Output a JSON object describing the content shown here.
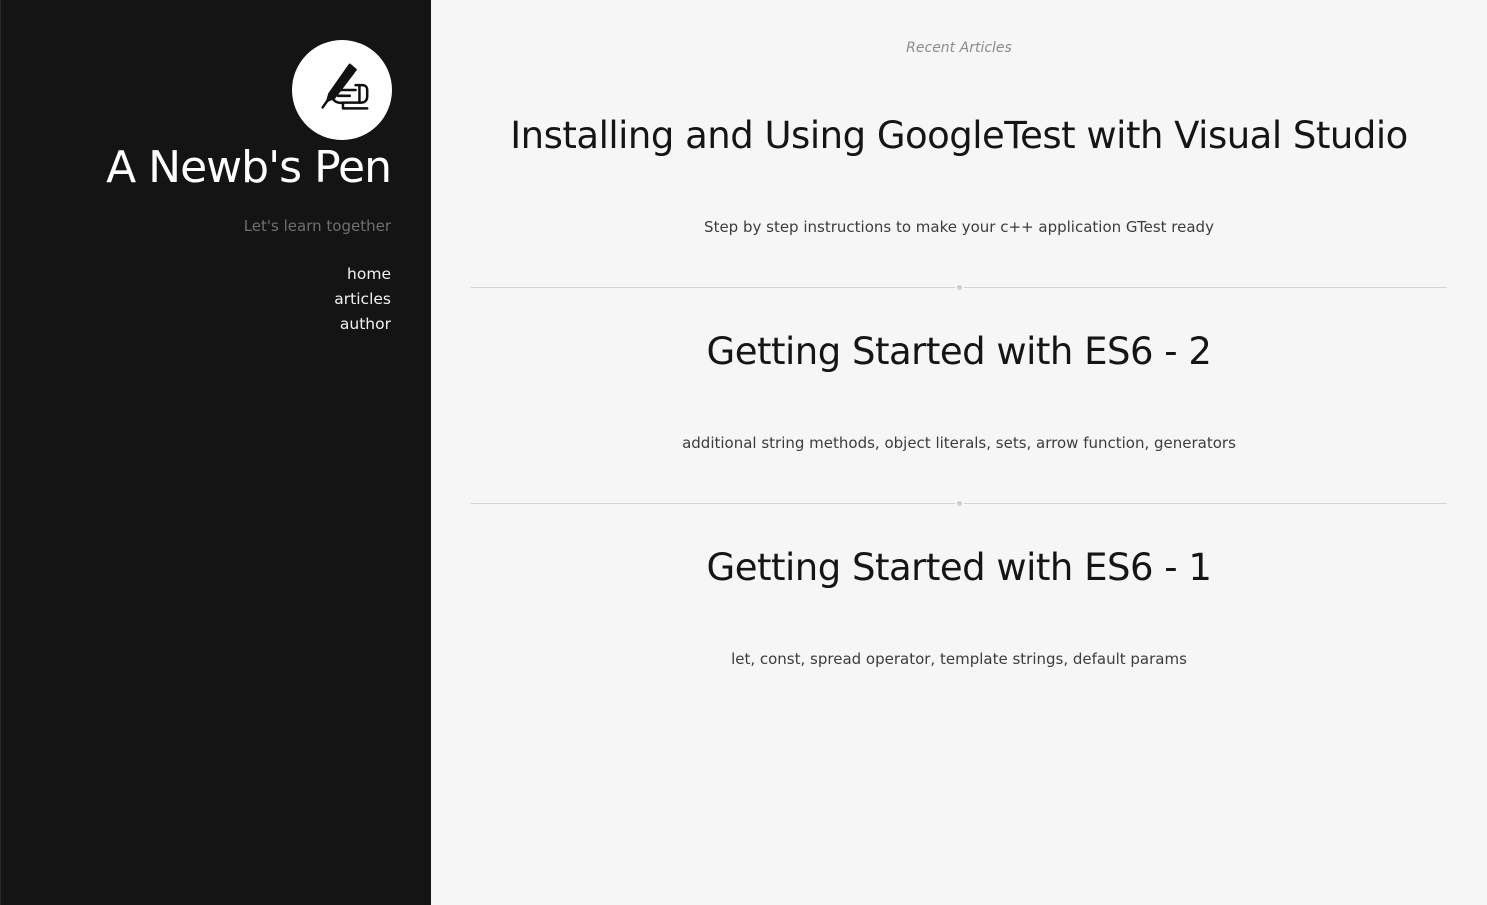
{
  "sidebar": {
    "avatar_icon": "writing-hand-icon",
    "site_title": "A Newb's Pen",
    "tagline": "Let's learn together",
    "nav": [
      {
        "label": "home"
      },
      {
        "label": "articles"
      },
      {
        "label": "author"
      }
    ]
  },
  "main": {
    "section_label": "Recent Articles",
    "articles": [
      {
        "title": "Installing and Using GoogleTest with Visual Studio",
        "description": "Step by step instructions to make your c++ application GTest ready"
      },
      {
        "title": "Getting Started with ES6 - 2",
        "description": "additional string methods, object literals, sets, arrow function, generators"
      },
      {
        "title": "Getting Started with ES6 - 1",
        "description": "let, const, spread operator, template strings, default params"
      }
    ]
  },
  "colors": {
    "sidebar_bg": "#141414",
    "main_bg": "#f6f6f6",
    "divider": "#d4d4d4"
  }
}
